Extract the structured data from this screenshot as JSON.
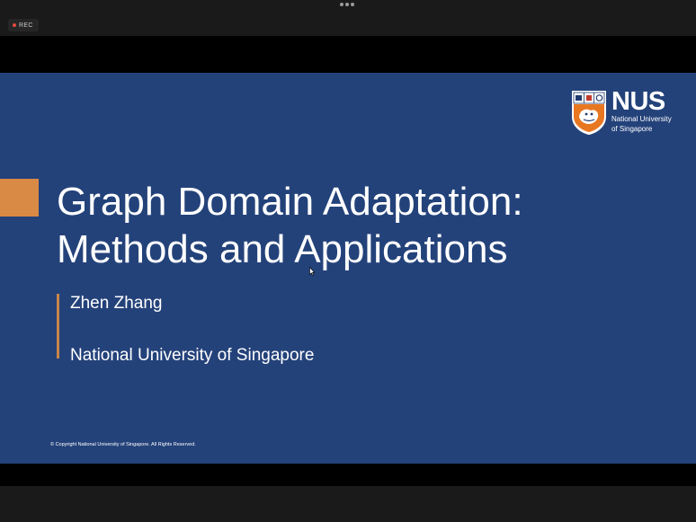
{
  "window": {
    "rec_label": "REC",
    "more_icon": "more-horizontal-icon"
  },
  "slide": {
    "logo": {
      "abbr": "NUS",
      "name_line1": "National University",
      "name_line2": "of Singapore",
      "crest_icon": "nus-crest-icon"
    },
    "title_line1": "Graph Domain Adaptation:",
    "title_line2": "Methods and Applications",
    "author": "Zhen Zhang",
    "affiliation": "National University of Singapore",
    "copyright": "© Copyright National University of Singapore. All Rights Reserved."
  },
  "colors": {
    "slide_background": "#24427a",
    "accent_orange": "#d98a45",
    "chrome_background": "#1a1a1a",
    "letterbox": "#000000",
    "rec_dot": "#e64b3c"
  }
}
